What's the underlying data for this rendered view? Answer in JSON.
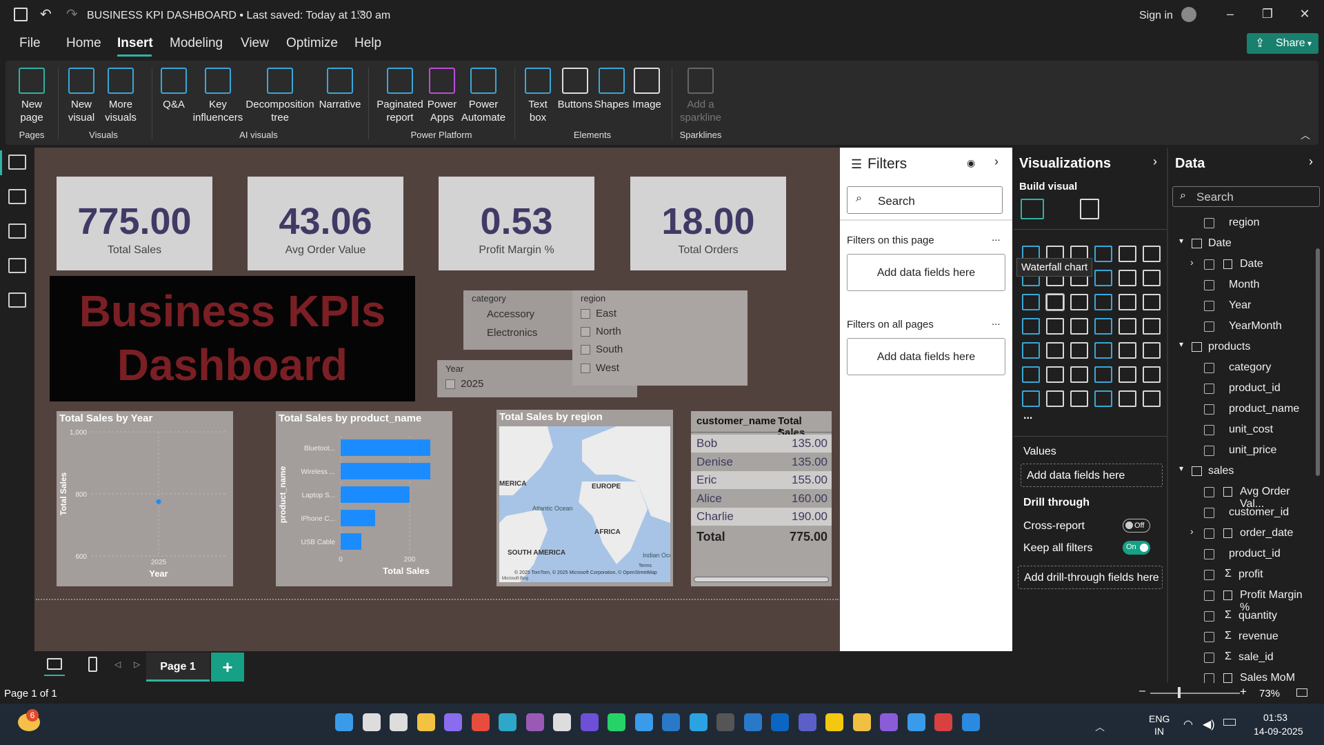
{
  "title_bar": {
    "title": "BUSINESS KPI DASHBOARD • Last saved: Today at 1:30 am",
    "sign_in": "Sign in"
  },
  "menu": {
    "file": "File",
    "home": "Home",
    "insert": "Insert",
    "modeling": "Modeling",
    "view": "View",
    "optimize": "Optimize",
    "help": "Help",
    "share": "Share"
  },
  "ribbon": {
    "new_page": "New page",
    "new_visual": "New visual",
    "more_visuals": "More visuals",
    "qa": "Q&A",
    "key_influencers": "Key influencers",
    "decomposition_tree": "Decomposition tree",
    "narrative": "Narrative",
    "paginated_report": "Paginated report",
    "power_apps": "Power Apps",
    "power_automate": "Power Automate",
    "text_box": "Text box",
    "buttons": "Buttons",
    "shapes": "Shapes",
    "image": "Image",
    "add_sparkline": "Add a sparkline",
    "groups": {
      "pages": "Pages",
      "visuals": "Visuals",
      "ai_visuals": "AI visuals",
      "power_platform": "Power Platform",
      "elements": "Elements",
      "sparklines": "Sparklines"
    }
  },
  "kpis": [
    {
      "value": "775.00",
      "label": "Total Sales"
    },
    {
      "value": "43.06",
      "label": "Avg Order Value"
    },
    {
      "value": "0.53",
      "label": "Profit Margin %"
    },
    {
      "value": "18.00",
      "label": "Total Orders"
    }
  ],
  "banner": {
    "line1": "Business KPIs",
    "line2": "Dashboard"
  },
  "slicers": {
    "category": {
      "title": "category",
      "items": [
        "Accessory",
        "Electronics"
      ]
    },
    "region": {
      "title": "region",
      "items": [
        "East",
        "North",
        "South",
        "West"
      ]
    },
    "year": {
      "title": "Year",
      "items": [
        "2025"
      ]
    }
  },
  "chart_data": [
    {
      "type": "scatter",
      "title": "Total Sales by Year",
      "xlabel": "Year",
      "ylabel": "Total Sales",
      "x": [
        "2025"
      ],
      "y": [
        775
      ],
      "yticks": [
        "1,000",
        "800",
        "600"
      ],
      "ylim": [
        600,
        1000
      ],
      "grid": true
    },
    {
      "type": "bar",
      "orientation": "horizontal",
      "title": "Total Sales by product_name",
      "xlabel": "Total Sales",
      "ylabel": "product_name",
      "categories": [
        "Bluetoot...",
        "Wireless ...",
        "Laptop S...",
        "iPhone C...",
        "USB Cable"
      ],
      "values": [
        260,
        260,
        200,
        100,
        60
      ],
      "xticks": [
        "0",
        "200"
      ],
      "xlim": [
        0,
        300
      ],
      "bar_color": "#1a8cff"
    }
  ],
  "map": {
    "title": "Total Sales by region",
    "labels": {
      "america": "MERICA",
      "europe": "EUROPE",
      "atlantic": "Atlantic Ocean",
      "africa": "AFRICA",
      "south_america": "SOUTH AMERICA",
      "indian": "Indian Ocean"
    },
    "credit": "© 2025 TomTom, © 2025 Microsoft Corporation, © OpenStreetMap",
    "terms": "Terms",
    "logo": "Microsoft Bing"
  },
  "table": {
    "headers": [
      "customer_name",
      "Total Sales"
    ],
    "rows": [
      [
        "Bob",
        "135.00"
      ],
      [
        "Denise",
        "135.00"
      ],
      [
        "Eric",
        "155.00"
      ],
      [
        "Alice",
        "160.00"
      ],
      [
        "Charlie",
        "190.00"
      ]
    ],
    "total_label": "Total",
    "total_value": "775.00"
  },
  "filters": {
    "title": "Filters",
    "search_placeholder": "Search",
    "this_page": "Filters on this page",
    "all_pages": "Filters on all pages",
    "add": "Add data fields here",
    "more": "..."
  },
  "visualizations": {
    "title": "Visualizations",
    "build": "Build visual",
    "tooltip": "Waterfall chart",
    "more": "...",
    "values": "Values",
    "add_fields": "Add data fields here",
    "drill_through": "Drill through",
    "cross_report": "Cross-report",
    "cross_report_state": "Off",
    "keep_filters": "Keep all filters",
    "keep_filters_state": "On",
    "add_drill": "Add drill-through fields here"
  },
  "data_pane": {
    "title": "Data",
    "search_placeholder": "Search",
    "rows": [
      {
        "label": "region",
        "kind": "field",
        "indent": 1
      },
      {
        "label": "Date",
        "kind": "table",
        "indent": 0
      },
      {
        "label": "Date",
        "kind": "hier",
        "indent": 1
      },
      {
        "label": "Month",
        "kind": "field",
        "indent": 1
      },
      {
        "label": "Year",
        "kind": "field",
        "indent": 1
      },
      {
        "label": "YearMonth",
        "kind": "field",
        "indent": 1
      },
      {
        "label": "products",
        "kind": "table",
        "indent": 0
      },
      {
        "label": "category",
        "kind": "field",
        "indent": 1
      },
      {
        "label": "product_id",
        "kind": "field",
        "indent": 1
      },
      {
        "label": "product_name",
        "kind": "field",
        "indent": 1
      },
      {
        "label": "unit_cost",
        "kind": "field",
        "indent": 1
      },
      {
        "label": "unit_price",
        "kind": "field",
        "indent": 1
      },
      {
        "label": "sales",
        "kind": "table",
        "indent": 0
      },
      {
        "label": "Avg Order Val...",
        "kind": "measure",
        "indent": 1
      },
      {
        "label": "customer_id",
        "kind": "field",
        "indent": 1
      },
      {
        "label": "order_date",
        "kind": "hier",
        "indent": 1
      },
      {
        "label": "product_id",
        "kind": "field",
        "indent": 1
      },
      {
        "label": "profit",
        "kind": "sum",
        "indent": 1
      },
      {
        "label": "Profit Margin %",
        "kind": "measure",
        "indent": 1
      },
      {
        "label": "quantity",
        "kind": "sum",
        "indent": 1
      },
      {
        "label": "revenue",
        "kind": "sum",
        "indent": 1
      },
      {
        "label": "sale_id",
        "kind": "sum",
        "indent": 1
      },
      {
        "label": "Sales MoM Gr...",
        "kind": "measure",
        "indent": 1
      }
    ]
  },
  "pages": {
    "current": "Page 1",
    "add": "+",
    "status": "Page 1 of 1",
    "zoom": "73%"
  },
  "taskbar": {
    "weather_badge": "6",
    "lang1": "ENG",
    "lang2": "IN",
    "time": "01:53",
    "date": "14-09-2025"
  }
}
